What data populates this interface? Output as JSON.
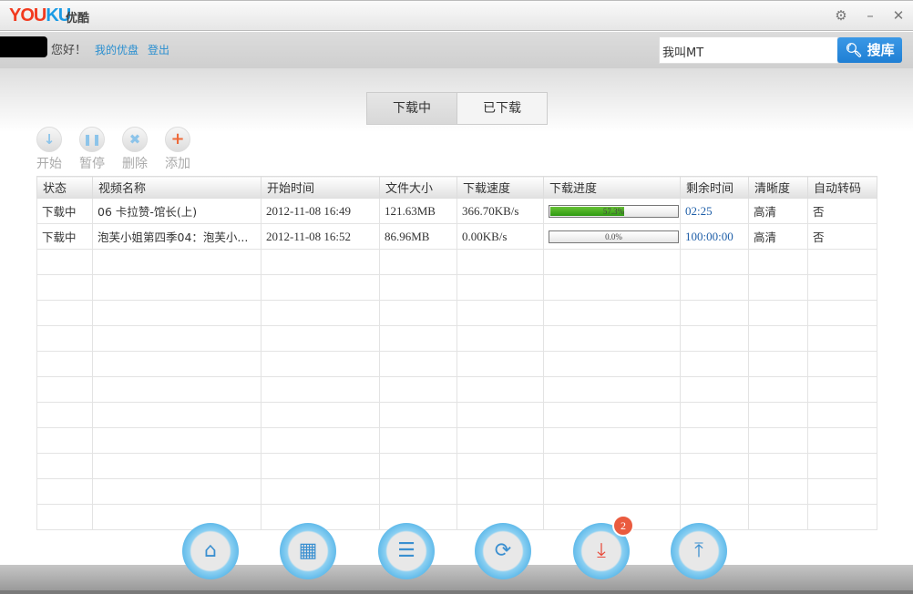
{
  "app": {
    "logo": "YOUKU",
    "logo_cn": "优酷"
  },
  "userbar": {
    "greeting": "您好！",
    "my_disk": "我的优盘",
    "logout": "登出"
  },
  "search": {
    "value": "我叫MT",
    "button": "搜库"
  },
  "tabs": [
    {
      "label": "下载中",
      "active": true
    },
    {
      "label": "已下载",
      "active": false
    }
  ],
  "toolbar": [
    {
      "label": "开始",
      "icon": "arrow-down"
    },
    {
      "label": "暂停",
      "icon": "pause"
    },
    {
      "label": "删除",
      "icon": "x"
    },
    {
      "label": "添加",
      "icon": "plus"
    }
  ],
  "table": {
    "headers": [
      "状态",
      "视频名称",
      "开始时间",
      "文件大小",
      "下载速度",
      "下载进度",
      "剩余时间",
      "清晰度",
      "自动转码"
    ],
    "rows": [
      {
        "status": "下载中",
        "name": "06 卡拉赞-馆长(上)",
        "start": "2012-11-08 16:49",
        "size": "121.63MB",
        "speed": "366.70KB/s",
        "progress": 57.3,
        "progress_label": "57.3%",
        "remaining": "02:25",
        "quality": "高清",
        "transcode": "否"
      },
      {
        "status": "下载中",
        "name": "泡芙小姐第四季04：泡芙小...",
        "start": "2012-11-08 16:52",
        "size": "86.96MB",
        "speed": "0.00KB/s",
        "progress": 0,
        "progress_label": "0.0%",
        "remaining": "100:00:00",
        "quality": "高清",
        "transcode": "否"
      }
    ]
  },
  "nav": [
    {
      "icon": "home-icon"
    },
    {
      "icon": "film-icon"
    },
    {
      "icon": "playlist-icon"
    },
    {
      "icon": "sync-icon"
    },
    {
      "icon": "download-icon",
      "badge": "2"
    },
    {
      "icon": "upload-icon"
    }
  ],
  "colors": {
    "accent": "#1f7fd4",
    "progress": "#3fa61c",
    "badge": "#ea5b3f"
  }
}
